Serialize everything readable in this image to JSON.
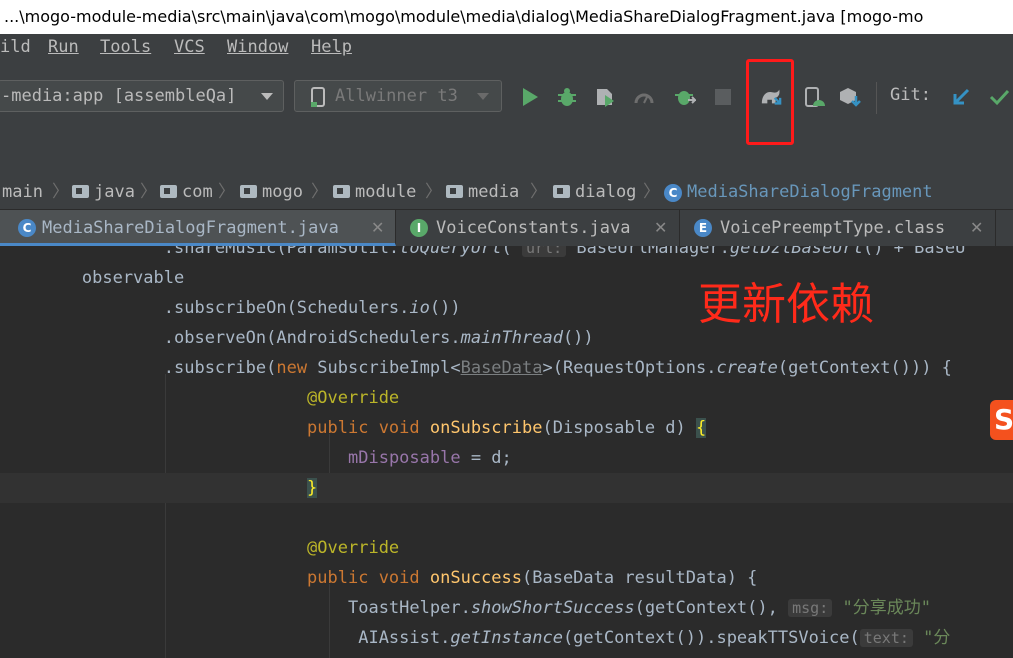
{
  "titlebar": {
    "text": "...\\mogo-module-media\\src\\main\\java\\com\\mogo\\module\\media\\dialog\\MediaShareDialogFragment.java [mogo-mo"
  },
  "menu": [
    {
      "label": "ild"
    },
    {
      "label": "Run"
    },
    {
      "label": "Tools"
    },
    {
      "label": "VCS"
    },
    {
      "label": "Window"
    },
    {
      "label": "Help"
    }
  ],
  "toolbar": {
    "run_config": "-media:app [assembleQa]",
    "device": "Allwinner t3",
    "git_label": "Git:",
    "icons": {
      "run": "run-icon",
      "debug": "debug-icon",
      "coverage": "coverage-icon",
      "profile": "profile-icon",
      "attach_debugger": "attach-debugger-icon",
      "stop": "stop-icon",
      "sync_gradle": "sync-gradle-icon",
      "avd_manager": "avd-manager-icon",
      "sdk_manager": "sdk-manager-icon",
      "vcs_update": "vcs-update-icon",
      "vcs_commit": "vcs-commit-icon"
    }
  },
  "breadcrumb": [
    "main",
    "java",
    "com",
    "mogo",
    "module",
    "media",
    "dialog",
    "MediaShareDialogFragment"
  ],
  "tabs": [
    {
      "label": "MediaShareDialogFragment.java",
      "icon_letter": "C",
      "close": "✕"
    },
    {
      "label": "VoiceConstants.java",
      "icon_letter": "I",
      "close": "✕"
    },
    {
      "label": "VoicePreemptType.class",
      "icon_letter": "E",
      "close": "✕"
    }
  ],
  "code": {
    "l0_pre": "                .shareMusic(ParamsUtil.",
    "l0_it": "toQueryUrl",
    "l0_mid": "( ",
    "l0_hint": "url:",
    "l0_post": " BaseUrlManager.",
    "l0_it2": "getDzlBaseUrl",
    "l0_end": "() + BaseU",
    "l1": "        observable",
    "l2_pre": "                .subscribeOn(Schedulers.",
    "l2_it": "io",
    "l2_post": "())",
    "l3_pre": "                .observeOn(AndroidSchedulers.",
    "l3_it": "mainThread",
    "l3_post": "())",
    "l4_pre": "                .subscribe(",
    "l4_kw": "new",
    "l4_mid": " SubscribeImpl<",
    "l4_ul": "BaseData",
    "l4_mid2": ">(RequestOptions.",
    "l4_it": "create",
    "l4_post": "(getContext())) {",
    "l5": "                              @Override",
    "l6_indent": "                              ",
    "l6_kw": "public void ",
    "l6_fn": "onSubscribe",
    "l6_post": "(Disposable d) ",
    "l6_brace": "{",
    "l7_indent": "                                  ",
    "l7_fld": "mDisposable",
    "l7_post": " = d;",
    "l8_indent": "                              ",
    "l8_brace": "}",
    "l10": "                              @Override",
    "l11_indent": "                              ",
    "l11_kw": "public void ",
    "l11_fn": "onSuccess",
    "l11_post": "(BaseData resultData) {",
    "l12_pre": "                                  ToastHelper.",
    "l12_it": "showShortSuccess",
    "l12_mid": "(getContext(), ",
    "l12_hint": "msg:",
    "l12_str": " \"分享成功\"",
    "l13_pre": "                                   AIAssist.",
    "l13_it": "getInstance",
    "l13_mid": "(getContext()).speakTTSVoice(",
    "l13_hint": "text:",
    "l13_str": " \"分"
  },
  "annotation": {
    "text": "更新依赖",
    "color": "#ff2a1a"
  },
  "sogou_badge": "S"
}
